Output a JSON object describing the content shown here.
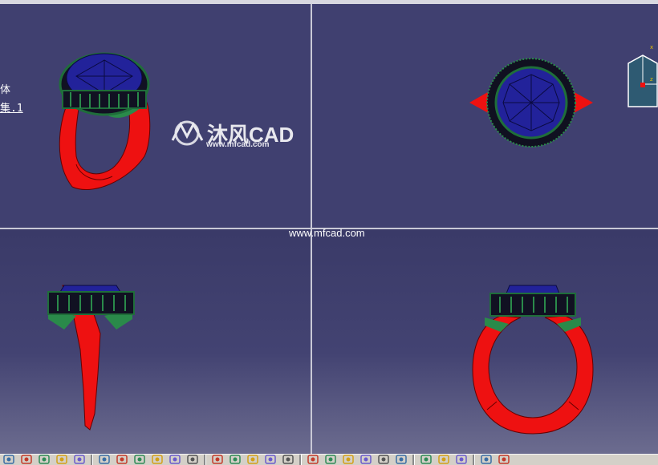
{
  "spec_tree": {
    "line1": "体",
    "line2": "集.1"
  },
  "watermark": {
    "brand": "沐风CAD",
    "site_small": "www.mfcad.com",
    "site_center": "www.mfcad.com"
  },
  "colors": {
    "background": "#404070",
    "metal": "#ee1111",
    "gem": "#22229a",
    "accent_stones": "#2a8a4a",
    "divider": "#c9c9d6"
  },
  "compass": {
    "axis_x": "x",
    "axis_z": "z"
  },
  "toolbar": {
    "icons": [
      "new-icon",
      "open-icon",
      "undo-icon",
      "redo-icon",
      "help-icon",
      "sep",
      "cut-icon",
      "fit-all-icon",
      "pan-icon",
      "rotate-icon",
      "zoom-icon",
      "fly-icon",
      "sep",
      "normal-view-icon",
      "cube-icon",
      "render-icon",
      "material-icon",
      "section-icon",
      "sep",
      "measure-icon",
      "grid-icon",
      "snap-icon",
      "ruler-icon",
      "analysis-icon",
      "light-icon",
      "sep",
      "update-icon",
      "distance-icon",
      "tool-icon",
      "sep",
      "camera-icon",
      "settings-icon"
    ]
  }
}
